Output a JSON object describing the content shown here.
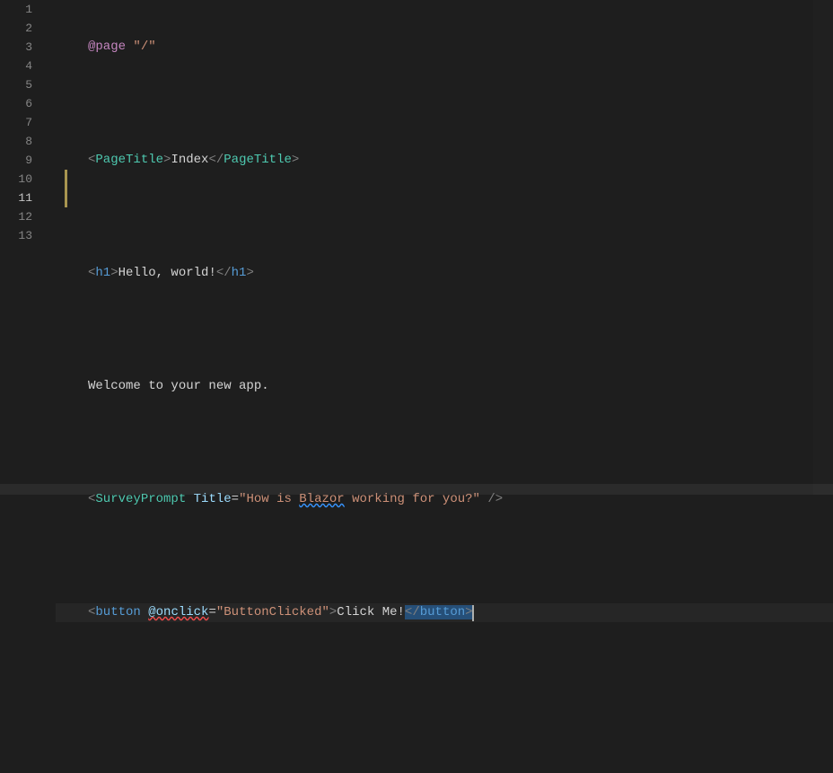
{
  "gutter": {
    "lines": [
      "1",
      "2",
      "3",
      "4",
      "5",
      "6",
      "7",
      "8",
      "9",
      "10",
      "11",
      "12",
      "13"
    ],
    "activeLine": 11
  },
  "code": {
    "l1": {
      "kw": "@page",
      "sp": " ",
      "str": "\"/\""
    },
    "l3": {
      "open_br": "<",
      "open_tag": "PageTitle",
      "open_br2": ">",
      "text": "Index",
      "close_br": "</",
      "close_tag": "PageTitle",
      "close_br2": ">"
    },
    "l5": {
      "open_br": "<",
      "open_tag": "h1",
      "open_br2": ">",
      "text": "Hello, world!",
      "close_br": "</",
      "close_tag": "h1",
      "close_br2": ">"
    },
    "l7": {
      "text": "Welcome to your new app."
    },
    "l9": {
      "open_br": "<",
      "tag": "SurveyPrompt",
      "sp": " ",
      "attr": "Title",
      "eq": "=",
      "q1": "\"",
      "str1": "How is ",
      "str_wavy": "Blazor",
      "str2": " working for you?",
      "q2": "\"",
      "end": " />"
    },
    "l11": {
      "open_br": "<",
      "open_tag": "button",
      "sp": " ",
      "attr_wavy": "@onclick",
      "eq": "=",
      "str": "\"ButtonClicked\"",
      "open_br2": ">",
      "text": "Click Me!",
      "sel_open_br": "<",
      "sel_slash": "/",
      "sel_tag": "button",
      "sel_close_br": ">"
    }
  }
}
